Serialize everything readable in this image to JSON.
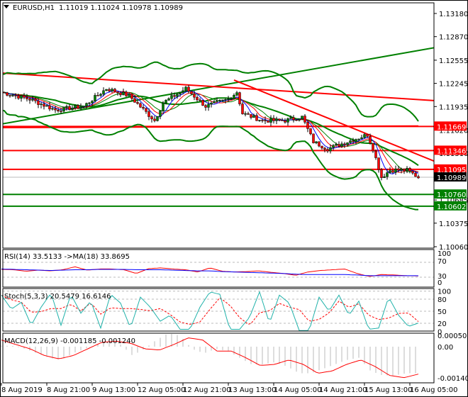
{
  "header": {
    "symbol": "EURUSD,H1",
    "ohlc": "1.11019 1.11024 1.10978 1.10989"
  },
  "chart_data": {
    "type": "candlestick",
    "bars": 148,
    "price_axis": {
      "max": 1.1318,
      "min": 1.1006,
      "ticks": [
        "1.13180",
        "1.12870",
        "1.12555",
        "1.12245",
        "1.11935",
        "1.11620",
        "1.11310",
        "1.10685",
        "1.10375",
        "1.10060"
      ]
    },
    "price_waypoints": [
      [
        0,
        1.12127
      ],
      [
        10,
        1.12033
      ],
      [
        19,
        1.1189
      ],
      [
        29,
        1.11938
      ],
      [
        37,
        1.12175
      ],
      [
        45,
        1.1208
      ],
      [
        54,
        1.11748
      ],
      [
        57,
        1.11985
      ],
      [
        65,
        1.12175
      ],
      [
        72,
        1.11938
      ],
      [
        80,
        1.12033
      ],
      [
        83,
        1.1213
      ],
      [
        85,
        1.11843
      ],
      [
        92,
        1.11748
      ],
      [
        100,
        1.11748
      ],
      [
        106,
        1.11796
      ],
      [
        110,
        1.11464
      ],
      [
        115,
        1.11369
      ],
      [
        122,
        1.11464
      ],
      [
        129,
        1.11558
      ],
      [
        131,
        1.11369
      ],
      [
        134,
        1.10989
      ],
      [
        137,
        1.11084
      ],
      [
        143,
        1.11084
      ],
      [
        147,
        1.10989
      ]
    ],
    "current_price": "1.10989",
    "levels": [
      {
        "value": "1.11669",
        "color": "#ff0000"
      },
      {
        "value": "1.11346",
        "color": "#ff0000"
      },
      {
        "value": "1.11095",
        "color": "#ff0000"
      },
      {
        "value": "1.10760",
        "color": "#008000"
      },
      {
        "value": "1.10602",
        "color": "#008000"
      }
    ],
    "trendlines": [
      {
        "from": [
          0,
          1.11701
        ],
        "to": [
          153,
          1.12725
        ],
        "color": "#008000"
      },
      {
        "from": [
          0,
          1.12383
        ],
        "to": [
          153,
          1.12014
        ],
        "color": "#ff0000"
      },
      {
        "from": [
          82,
          1.12289
        ],
        "to": [
          153,
          1.11198
        ],
        "color": "#ff0000"
      },
      {
        "from": [
          0,
          1.11653
        ],
        "to": [
          147,
          1.11675
        ],
        "color": "#ff0000"
      }
    ],
    "time_labels": [
      "8 Aug 2019",
      "8 Aug 21:00",
      "9 Aug 13:00",
      "12 Aug 05:00",
      "12 Aug 21:00",
      "13 Aug 13:00",
      "14 Aug 05:00",
      "14 Aug 21:00",
      "15 Aug 13:00",
      "16 Aug 05:00"
    ],
    "rsi": {
      "label": "RSI(14) 33.5133  ->MA(18) 33.8695",
      "ticks": [
        "100",
        "70",
        "30",
        "0"
      ],
      "values": [
        51,
        50,
        46,
        49,
        47,
        50,
        58,
        49,
        52,
        52,
        50,
        40,
        53,
        55,
        52,
        50,
        44,
        55,
        46,
        44,
        45,
        47,
        43,
        40,
        35,
        44,
        48,
        50,
        52,
        40,
        32,
        37,
        36,
        34,
        33.5
      ],
      "ma": [
        52,
        51,
        50,
        49,
        48,
        49,
        50,
        50,
        51,
        51,
        51,
        50,
        50,
        50,
        49,
        48,
        47,
        47,
        45,
        44,
        43,
        42,
        41,
        40,
        38,
        37,
        37,
        37,
        37,
        36,
        34,
        34,
        34,
        34,
        33.9
      ]
    },
    "stoch": {
      "label": "Stoch(5,3,3) 20.5479 16.6146",
      "ticks": [
        "100",
        "80",
        "50",
        "20",
        "0"
      ],
      "k": [
        90,
        55,
        72,
        15,
        60,
        95,
        15,
        92,
        45,
        75,
        8,
        92,
        70,
        8,
        85,
        60,
        25,
        40,
        5,
        5,
        60,
        98,
        92,
        5,
        5,
        35,
        98,
        20,
        90,
        70,
        2,
        2,
        85,
        50,
        90,
        40,
        75,
        5,
        8,
        85,
        40,
        12,
        20.5
      ]
    },
    "macd": {
      "label": "MACD(12,26,9) -0.001185 -0.001240",
      "ticks": [
        "0.000508",
        "0.00",
        "-0.001409"
      ],
      "hist": [
        5e-05,
        3e-05,
        -0.0001,
        -0.0003,
        -0.0005,
        -0.0006,
        -0.0003,
        -0.0001,
        0.0001,
        0.0002,
        0.0001,
        -0.0004,
        -0.0001,
        0.0003,
        0.0006,
        0.0005,
        -0.0001,
        -0.0003,
        -0.0001,
        -0.0002,
        -0.0005,
        -0.0008,
        -0.0008,
        -0.0007,
        -0.0009,
        -0.0012,
        -0.0012,
        -0.001,
        -0.0008,
        -0.0006,
        -0.0005,
        -0.0011,
        -0.0013,
        -0.0013,
        -0.0012,
        -0.0012
      ],
      "signal": [
        0.0003,
        0.0001,
        -0.0001,
        -0.0004,
        -0.00055,
        -0.0004,
        -0.0001,
        0.0002,
        0.00025,
        0.00015,
        -0.0001,
        -0.00015,
        0.0001,
        0.0004,
        0.0003,
        -0.0002,
        -0.0002,
        -0.0005,
        -0.00085,
        -0.0008,
        -0.0006,
        -0.0008,
        -0.0012,
        -0.0011,
        -0.0008,
        -0.0006,
        -0.0009,
        -0.0013,
        -0.0014,
        -0.00124
      ]
    }
  }
}
